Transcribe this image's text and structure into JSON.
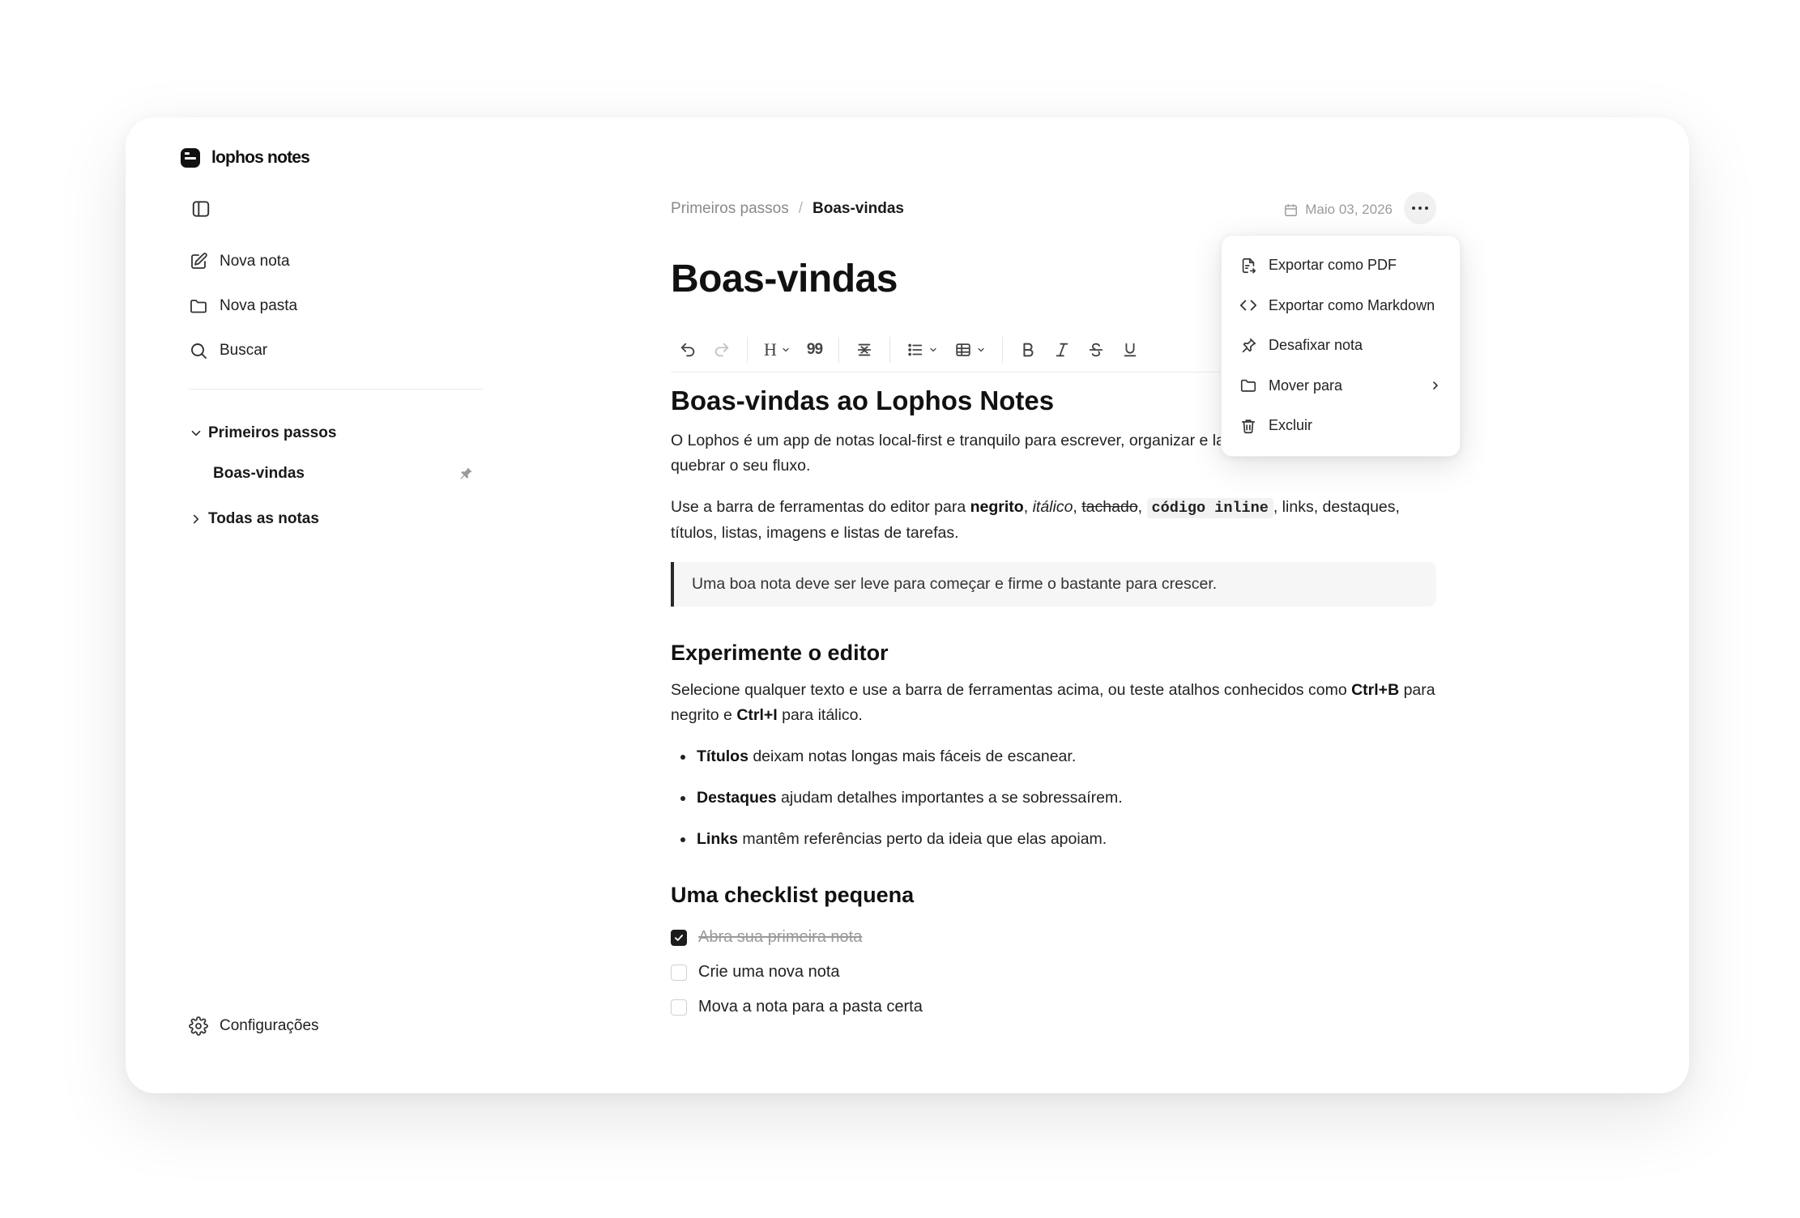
{
  "app": {
    "name": "lophos notes"
  },
  "sidebar": {
    "actions": [
      {
        "label": "Nova nota",
        "icon": "edit-icon"
      },
      {
        "label": "Nova pasta",
        "icon": "folder-icon"
      },
      {
        "label": "Buscar",
        "icon": "search-icon"
      }
    ],
    "tree": {
      "folder": "Primeiros passos",
      "note": "Boas-vindas",
      "folder2": "Todas as notas"
    },
    "settings_label": "Configurações"
  },
  "header": {
    "breadcrumb": {
      "parent": "Primeiros passos",
      "separator": "/",
      "current": "Boas-vindas"
    },
    "date": "Maio 03, 2026"
  },
  "document": {
    "title": "Boas-vindas",
    "h1": "Boas-vindas ao Lophos Notes",
    "intro": "O Lophos é um app de notas local-first e tranquilo para escrever, organizar e lapidar suas ideias sem quebrar o seu fluxo.",
    "p2": {
      "before": "Use a barra de ferramentas do editor para ",
      "bold": "negrito",
      "comma1": ", ",
      "italic": "itálico",
      "comma2": ", ",
      "strike": "tachado",
      "comma3": ", ",
      "code": "código inline",
      "after": ", links, destaques, títulos, listas, imagens e listas de tarefas."
    },
    "quote": "Uma boa nota deve ser leve para começar e firme o bastante para crescer.",
    "h2a": "Experimente o editor",
    "p3": {
      "before": "Selecione qualquer texto e use a barra de ferramentas acima, ou teste atalhos conhecidos como ",
      "k1": "Ctrl+B",
      "mid": " para negrito e ",
      "k2": "Ctrl+I",
      "after": " para itálico."
    },
    "bullets": [
      {
        "bold": "Títulos",
        "rest": " deixam notas longas mais fáceis de escanear."
      },
      {
        "bold": "Destaques",
        "rest": " ajudam detalhes importantes a se sobressaírem."
      },
      {
        "bold": "Links",
        "rest": " mantêm referências perto da ideia que elas apoiam."
      }
    ],
    "h2b": "Uma checklist pequena",
    "checklist": [
      {
        "label": "Abra sua primeira nota",
        "checked": true
      },
      {
        "label": "Crie uma nova nota",
        "checked": false
      },
      {
        "label": "Mova a nota para a pasta certa",
        "checked": false
      }
    ]
  },
  "toolbar": {
    "heading_label": "H",
    "quote_label": "99"
  },
  "menu": {
    "items": [
      {
        "label": "Exportar como PDF",
        "icon": "file-export-icon"
      },
      {
        "label": "Exportar como Markdown",
        "icon": "code-icon"
      },
      {
        "label": "Desafixar nota",
        "icon": "pin-icon"
      },
      {
        "label": "Mover para",
        "icon": "folder-icon"
      },
      {
        "label": "Excluir",
        "icon": "trash-icon"
      }
    ]
  }
}
